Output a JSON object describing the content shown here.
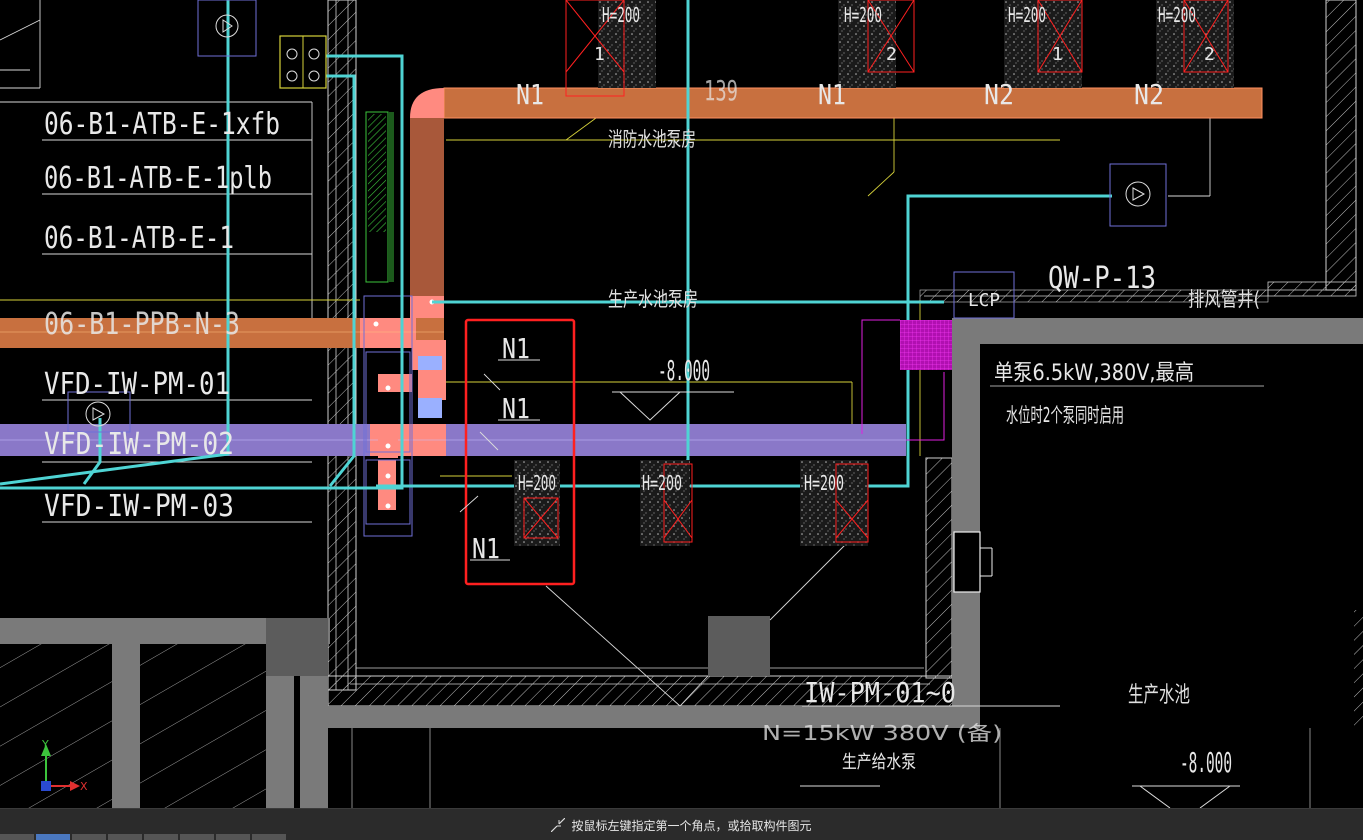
{
  "drawing": {
    "left_labels": [
      "06-B1-ATB-E-1xfb",
      "06-B1-ATB-E-1plb",
      "06-B1-ATB-E-1",
      "06-B1-PPB-N-3",
      "VFD-IW-PM-01",
      "VFD-IW-PM-02",
      "VFD-IW-PM-03"
    ],
    "pipe_labels": {
      "n1_a": "N1",
      "n_139": "139",
      "n1_b": "N1",
      "n2_a": "N2",
      "n2_b": "N2",
      "box_n1_top": "N1",
      "box_n1_mid": "N1",
      "box_n1_bot": "N1"
    },
    "room_labels": {
      "fire_pump_room": "消防水池泵房",
      "prod_pump_room": "生产水池泵房",
      "prod_pool": "生产水池",
      "exhaust_shaft": "排风管井("
    },
    "elevations": {
      "pump_room": "-8.000",
      "pool": "-8.000"
    },
    "equipment": {
      "qw_tag": "QW-P-13",
      "lcp_tag": "LCP",
      "pump_note_1": "单泵6.5kW,380V,最高",
      "pump_note_2": "水位时2个泵同时启用",
      "pump_group_tag": "IW-PM-01~0",
      "pump_spec_partial": "N=15kW 380V (备)",
      "pump_name_partial": "生产给水泵",
      "pit_height_label": "H=200",
      "pit_num_1": "1",
      "pit_num_2": "2"
    },
    "pits_top": [
      {
        "h": "H=200",
        "n": "1"
      },
      {
        "h": "H=200",
        "n": "2"
      },
      {
        "h": "H=200",
        "n": "1"
      },
      {
        "h": "H=200",
        "n": "2"
      }
    ],
    "pits_bottom": [
      {
        "h": "H=200"
      },
      {
        "h": "H=200"
      },
      {
        "h": "H=200"
      }
    ],
    "ucs": {
      "x": "X",
      "y": "Y"
    },
    "colors": {
      "orange_duct": "#c8703f",
      "purple_duct": "#8a78c8",
      "cyan_pipe": "#4fd4d4",
      "wall_gray": "#7a7a7a",
      "red_box": "#ff2020",
      "magenta": "#e020e0"
    }
  },
  "status": {
    "prompt": "按鼠标左键指定第一个角点，或拾取构件图元",
    "icon": "crosshair-cursor-icon"
  }
}
